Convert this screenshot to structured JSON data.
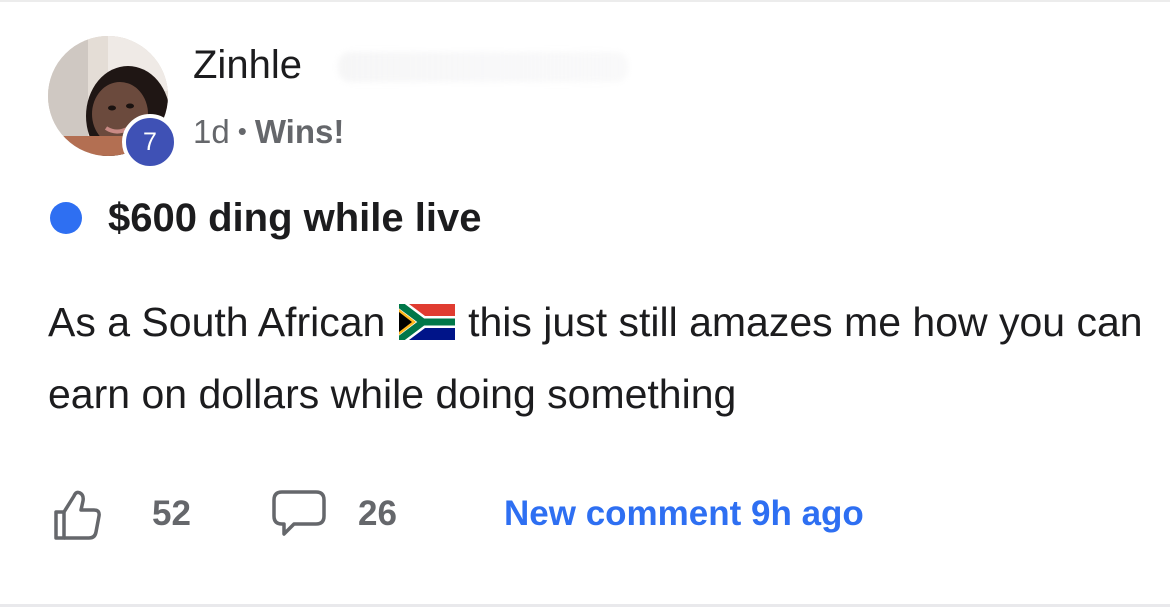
{
  "post": {
    "author": {
      "name": "Zinhle",
      "level": "7",
      "avatar_icon": "avatar-photo"
    },
    "time_ago": "1d",
    "separator": "•",
    "category": "Wins!",
    "title": "$600 ding while live",
    "unread_indicator_color": "#2e6ff2",
    "body": {
      "before_flag": "As a South African ",
      "flag_icon": "south-africa-flag",
      "after_flag": " this just still amazes me how you can earn on dollars while doing something"
    },
    "likes": "52",
    "comments": "26",
    "new_comment_text": "New comment 9h ago"
  },
  "colors": {
    "accent": "#2e6ff2",
    "level_badge": "#3f51b5",
    "muted_text": "#65676b",
    "primary_text": "#1c1c1e"
  }
}
